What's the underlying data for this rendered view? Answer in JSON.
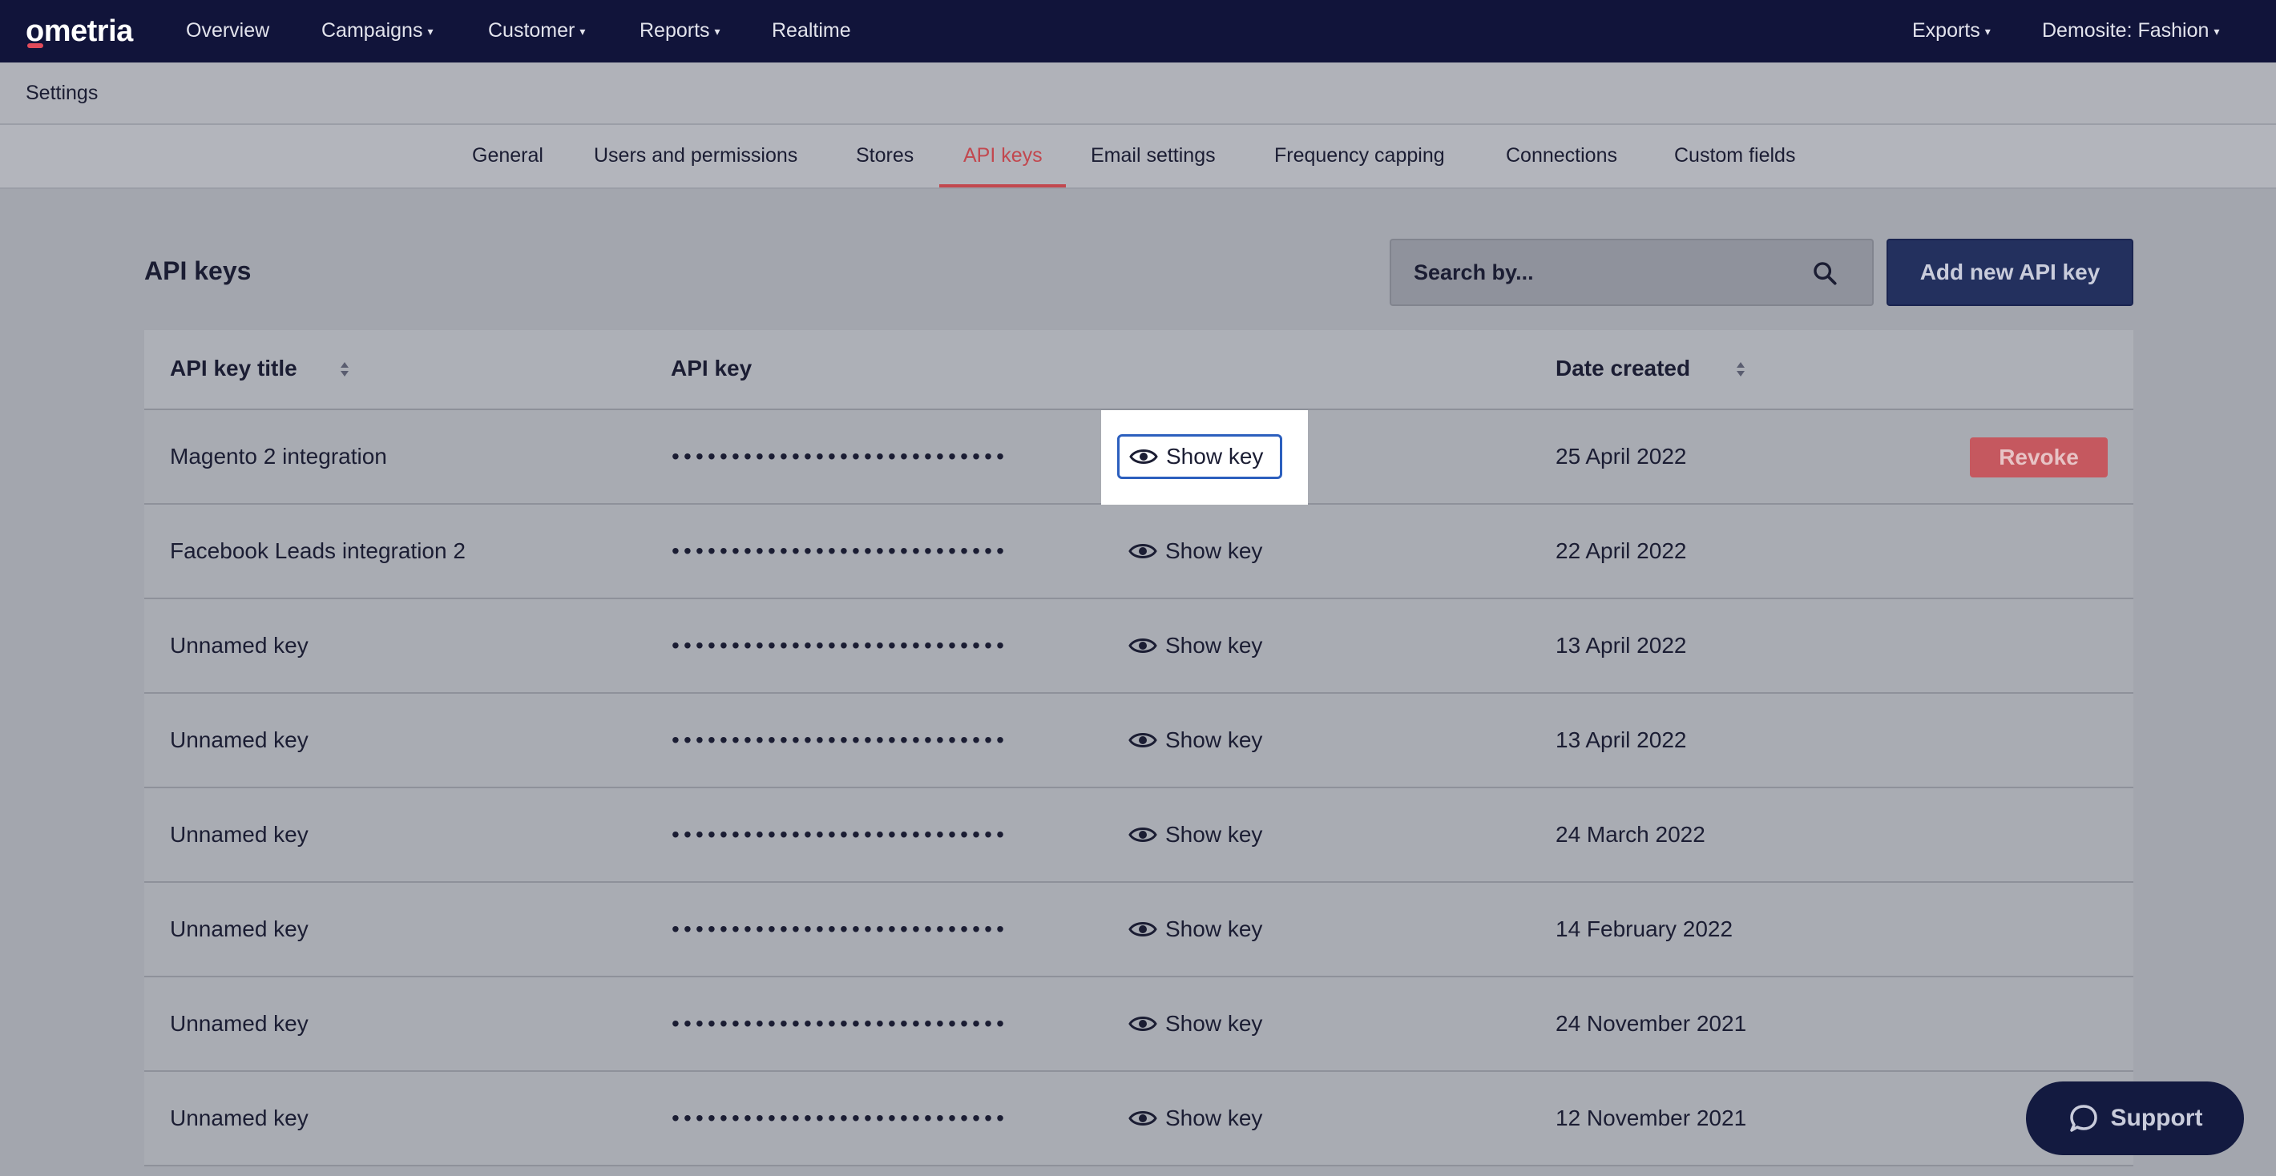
{
  "brand": {
    "name": "ometria"
  },
  "topnav": {
    "left": [
      {
        "label": "Overview",
        "caret": false
      },
      {
        "label": "Campaigns",
        "caret": true
      },
      {
        "label": "Customer",
        "caret": true
      },
      {
        "label": "Reports",
        "caret": true
      },
      {
        "label": "Realtime",
        "caret": false
      }
    ],
    "exports": "Exports",
    "account": "Demosite: Fashion"
  },
  "settings_title": "Settings",
  "tabs": [
    {
      "label": "General"
    },
    {
      "label": "Users and permissions"
    },
    {
      "label": "Stores"
    },
    {
      "label": "API keys",
      "active": true
    },
    {
      "label": "Email settings"
    },
    {
      "label": "Frequency capping"
    },
    {
      "label": "Connections"
    },
    {
      "label": "Custom fields"
    }
  ],
  "page": {
    "title": "API keys",
    "search_placeholder": "Search by...",
    "add_button": "Add new API key"
  },
  "table": {
    "columns": [
      "API key title",
      "API key",
      "Date created"
    ],
    "masked_key": "••••••••••••••••••••••••••••",
    "show_key_label": "Show key",
    "revoke_label": "Revoke",
    "rows": [
      {
        "title": "Magento 2 integration",
        "date": "25 April 2022"
      },
      {
        "title": "Facebook Leads integration 2",
        "date": "22 April 2022"
      },
      {
        "title": "Unnamed key",
        "date": "13 April 2022"
      },
      {
        "title": "Unnamed key",
        "date": "13 April 2022"
      },
      {
        "title": "Unnamed key",
        "date": "24 March 2022"
      },
      {
        "title": "Unnamed key",
        "date": "14 February 2022"
      },
      {
        "title": "Unnamed key",
        "date": "24 November 2021"
      },
      {
        "title": "Unnamed key",
        "date": "12 November 2021"
      }
    ]
  },
  "support": {
    "label": "Support"
  },
  "colors": {
    "nav_bg": "#11143a",
    "accent_active": "#c2484f",
    "primary_button": "#23305e",
    "revoke": "#c5585f",
    "focus_ring": "#2c5fbe"
  }
}
